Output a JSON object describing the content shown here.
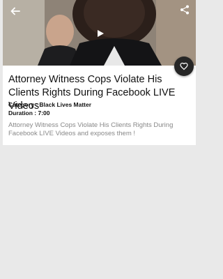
{
  "video": {
    "thumbnail": "man-in-suit-speaking-to-camera",
    "back_icon": "arrow-left-icon",
    "share_icon": "share-icon",
    "play_icon": "play-icon",
    "favorite_icon": "heart-outline-icon"
  },
  "post": {
    "title": "Attorney Witness Cops Violate His Clients Rights During Facebook LIVE Videos",
    "category_text": "Category : Black Lives Matter",
    "duration_text": "Duration : 7:00",
    "description": "Attorney Witness Cops Violate His Clients Rights During Facebook LIVE Videos and exposes them !"
  },
  "colors": {
    "page_background": "#e9e9e9",
    "card_background": "#ffffff",
    "favorite_button": "#262626",
    "description_text": "#888888"
  }
}
